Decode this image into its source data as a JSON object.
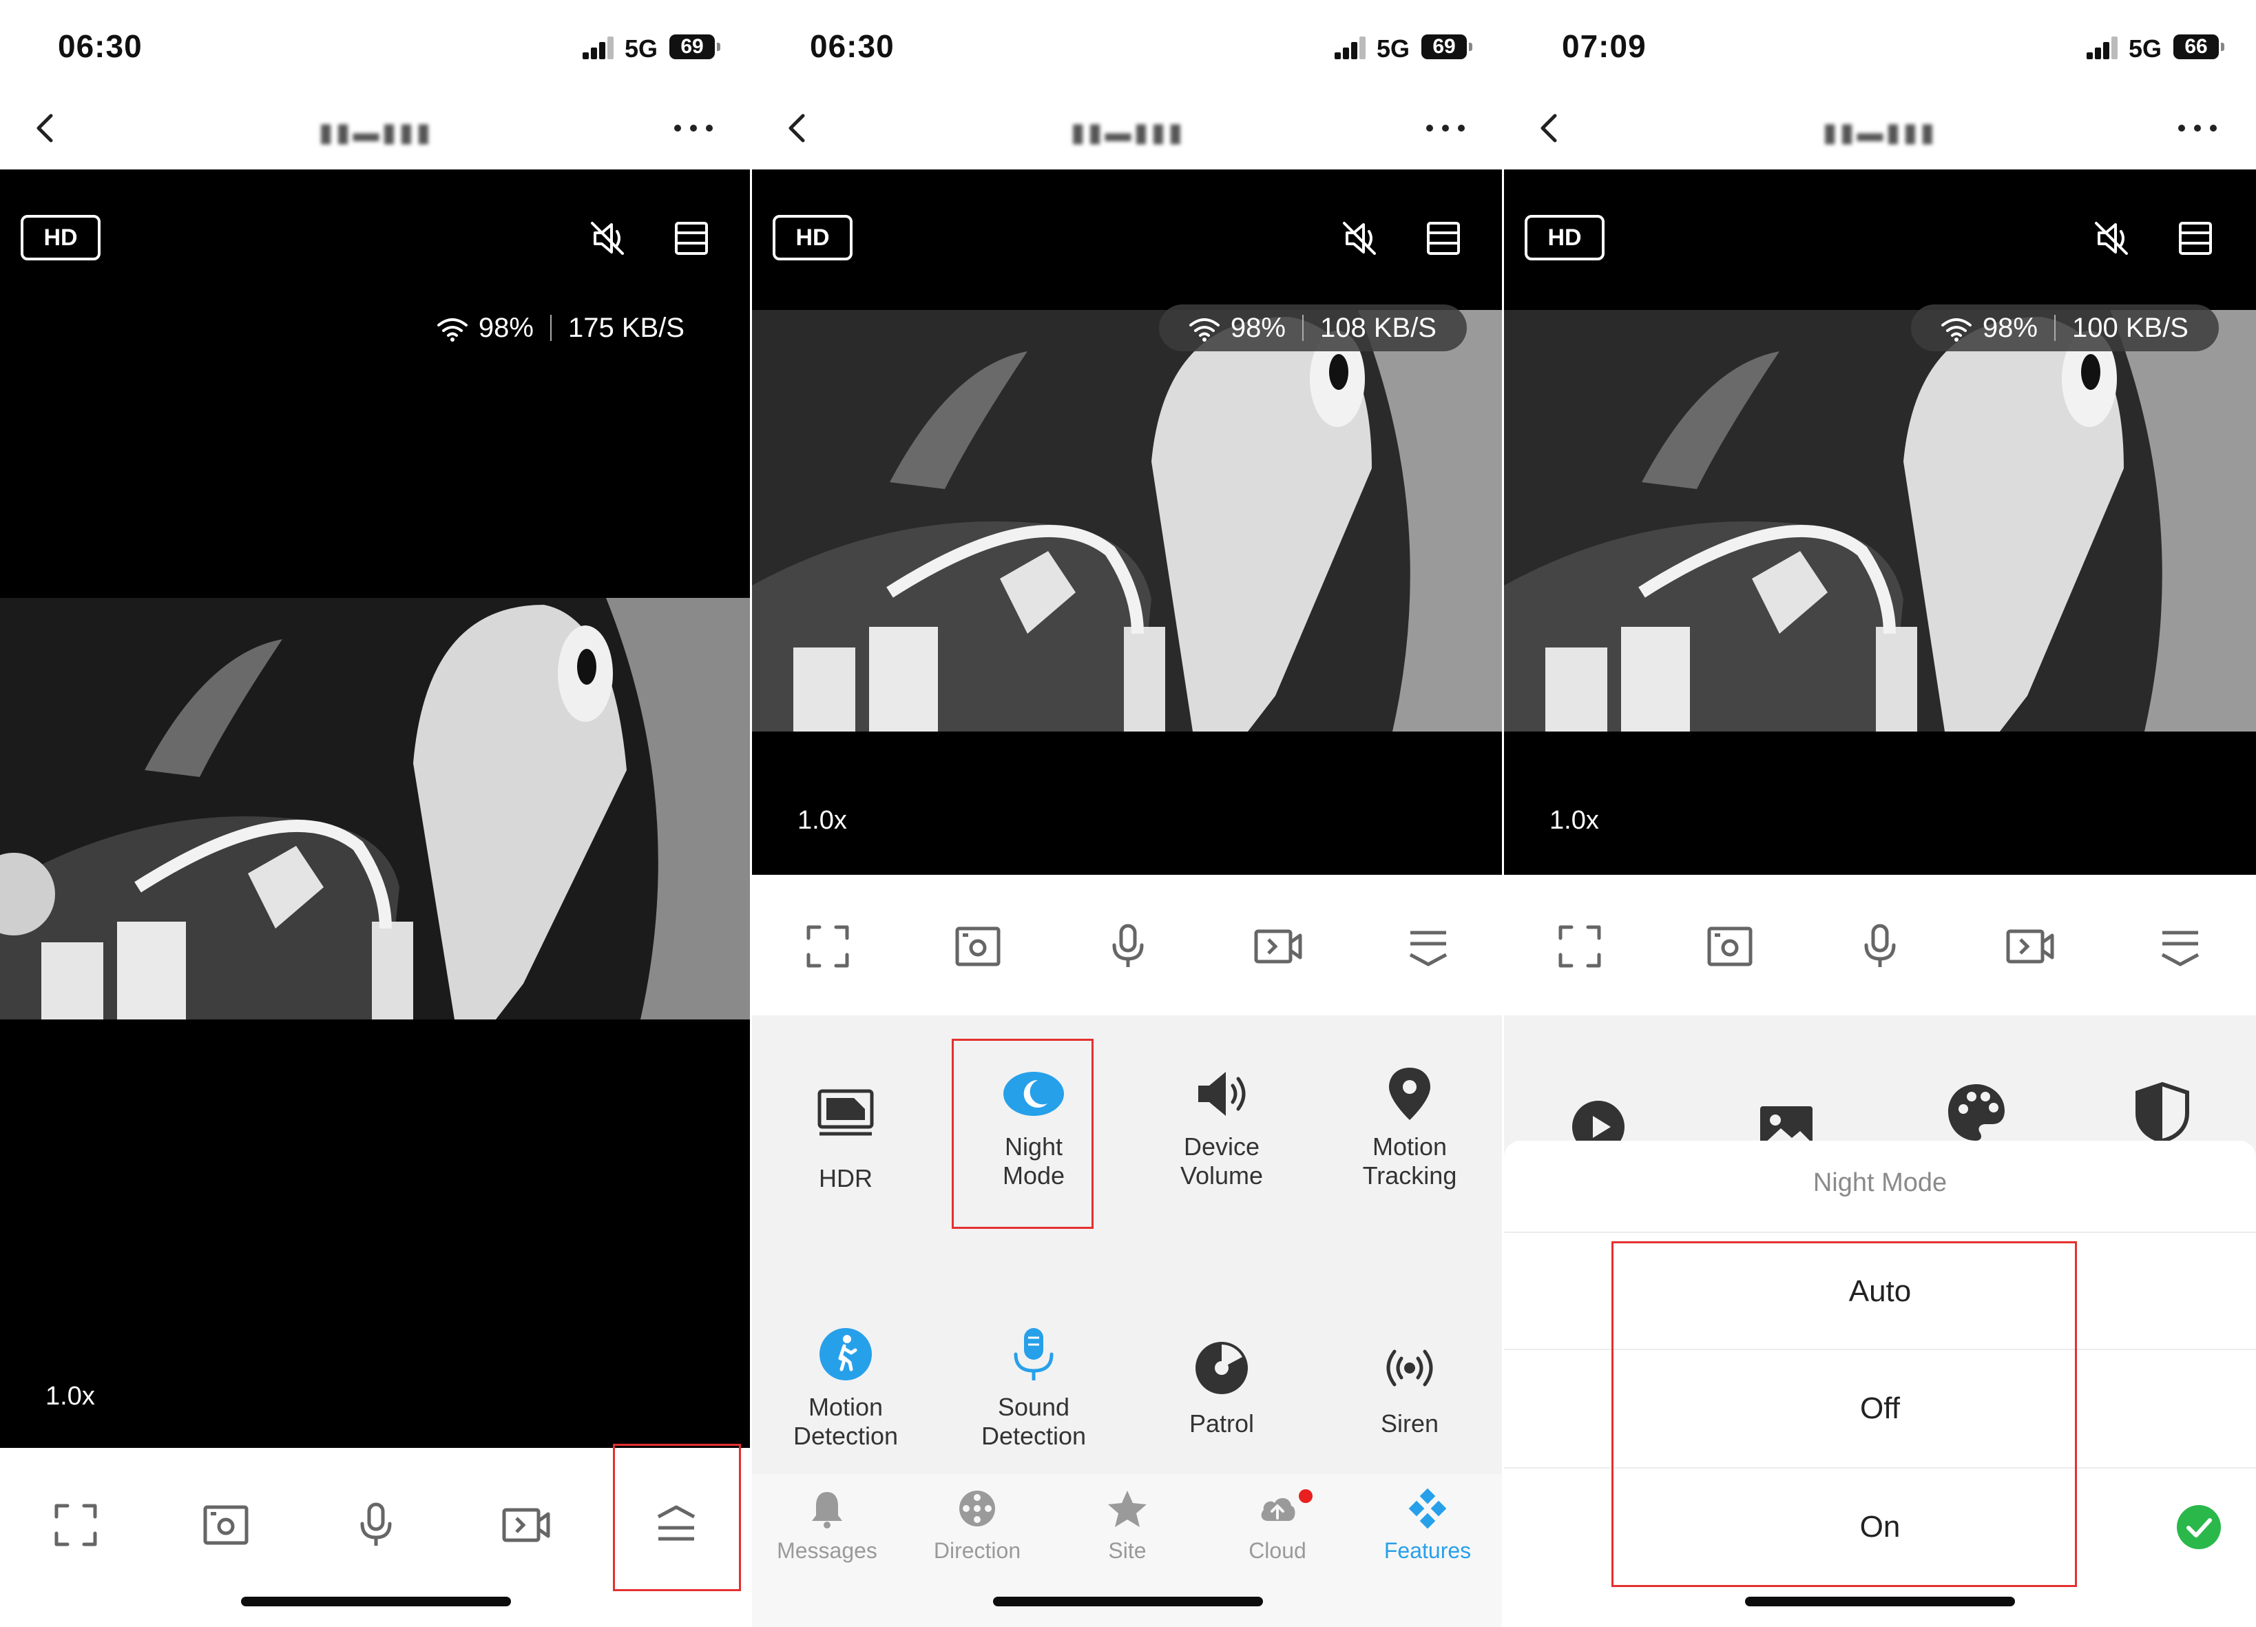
{
  "panels": [
    {
      "status": {
        "time": "06:30",
        "network": "5G",
        "battery": "69"
      },
      "viewer": {
        "quality": "HD",
        "wifi": "98%",
        "rate": "175 KB/S",
        "zoom": "1.0x"
      }
    },
    {
      "status": {
        "time": "06:30",
        "network": "5G",
        "battery": "69"
      },
      "viewer": {
        "quality": "HD",
        "wifi": "98%",
        "rate": "108 KB/S",
        "zoom": "1.0x"
      },
      "features": [
        {
          "label": "HDR",
          "icon": "hdr-icon"
        },
        {
          "label": "Night\nMode",
          "icon": "night-mode-icon"
        },
        {
          "label": "Device\nVolume",
          "icon": "speaker-icon"
        },
        {
          "label": "Motion\nTracking",
          "icon": "location-pin-icon"
        },
        {
          "label": "Motion\nDetection",
          "icon": "walking-person-icon"
        },
        {
          "label": "Sound\nDetection",
          "icon": "microphone-icon"
        },
        {
          "label": "Patrol",
          "icon": "patrol-icon"
        },
        {
          "label": "Siren",
          "icon": "siren-icon"
        }
      ],
      "tabs": [
        {
          "label": "Messages",
          "icon": "bell-icon"
        },
        {
          "label": "Direction",
          "icon": "direction-pad-icon"
        },
        {
          "label": "Site",
          "icon": "star-icon"
        },
        {
          "label": "Cloud",
          "icon": "cloud-upload-icon"
        },
        {
          "label": "Features",
          "icon": "features-icon"
        }
      ]
    },
    {
      "status": {
        "time": "07:09",
        "network": "5G",
        "battery": "66"
      },
      "viewer": {
        "quality": "HD",
        "wifi": "98%",
        "rate": "100 KB/S",
        "zoom": "1.0x"
      },
      "sheet": {
        "title": "Night Mode",
        "options": [
          "Auto",
          "Off",
          "On"
        ],
        "selected": "On"
      }
    }
  ],
  "colors": {
    "accent": "#27a0ea",
    "highlight": "#e53030",
    "check": "#2ab84b"
  }
}
